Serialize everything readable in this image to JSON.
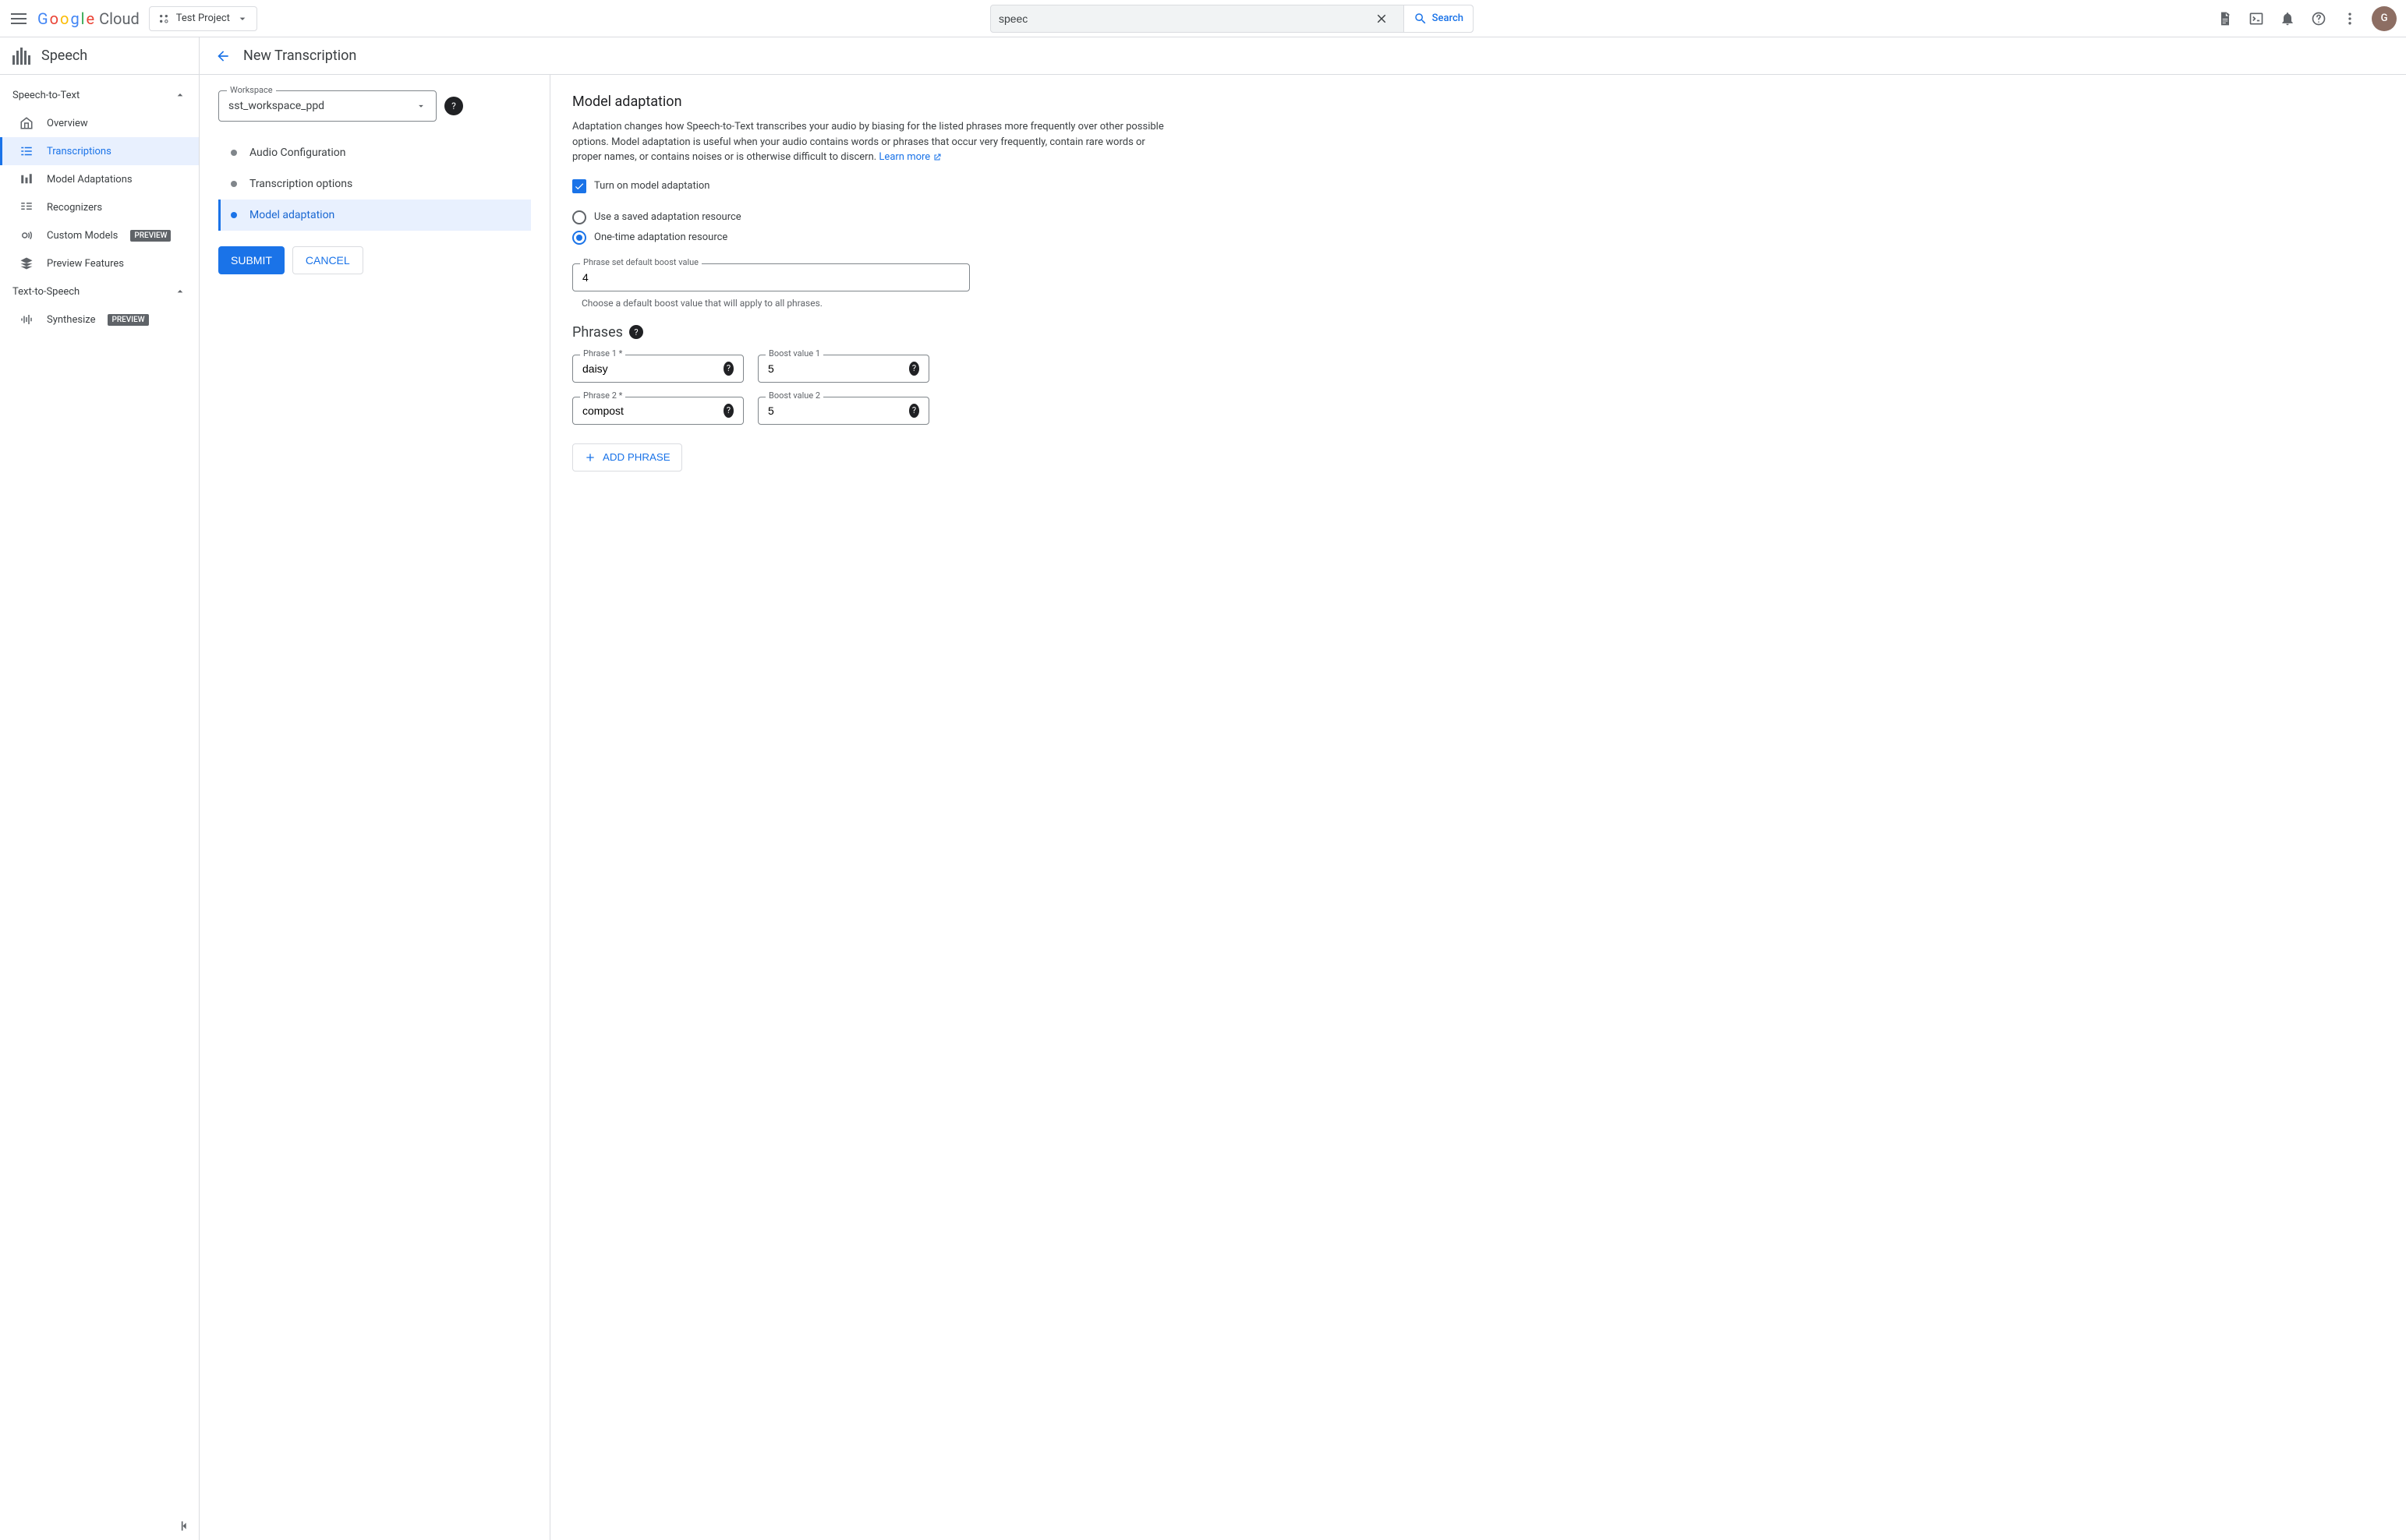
{
  "logo": {
    "cloud": "Cloud"
  },
  "project": {
    "name": "Test Project"
  },
  "search": {
    "value": "speec",
    "button": "Search"
  },
  "avatar": "G",
  "product": {
    "name": "Speech"
  },
  "page": {
    "title": "New Transcription"
  },
  "sidebar": {
    "section1": "Speech-to-Text",
    "items": [
      {
        "label": "Overview"
      },
      {
        "label": "Transcriptions"
      },
      {
        "label": "Model Adaptations"
      },
      {
        "label": "Recognizers"
      },
      {
        "label": "Custom Models"
      },
      {
        "label": "Preview Features"
      }
    ],
    "preview_badge": "PREVIEW",
    "section2": "Text-to-Speech",
    "items2": [
      {
        "label": "Synthesize"
      }
    ]
  },
  "workspace": {
    "label": "Workspace",
    "value": "sst_workspace_ppd"
  },
  "steps": [
    {
      "label": "Audio Configuration"
    },
    {
      "label": "Transcription options"
    },
    {
      "label": "Model adaptation"
    }
  ],
  "buttons": {
    "submit": "SUBMIT",
    "cancel": "CANCEL"
  },
  "detail": {
    "title": "Model adaptation",
    "desc": "Adaptation changes how Speech-to-Text transcribes your audio by biasing for the listed phrases more frequently over other possible options. Model adaptation is useful when your audio contains words or phrases that occur very frequently, contain rare words or proper names, or contains noises or is otherwise difficult to discern. ",
    "learn_more": "Learn more",
    "checkbox": "Turn on model adaptation",
    "radio1": "Use a saved adaptation resource",
    "radio2": "One-time adaptation resource",
    "boost_label": "Phrase set default boost value",
    "boost_value": "4",
    "boost_hint": "Choose a default boost value that will apply to all phrases.",
    "phrases_title": "Phrases",
    "phrases": [
      {
        "phrase_label": "Phrase 1 *",
        "phrase": "daisy",
        "boost_label": "Boost value 1",
        "boost": "5"
      },
      {
        "phrase_label": "Phrase 2 *",
        "phrase": "compost",
        "boost_label": "Boost value 2",
        "boost": "5"
      }
    ],
    "add_phrase": "ADD PHRASE"
  }
}
